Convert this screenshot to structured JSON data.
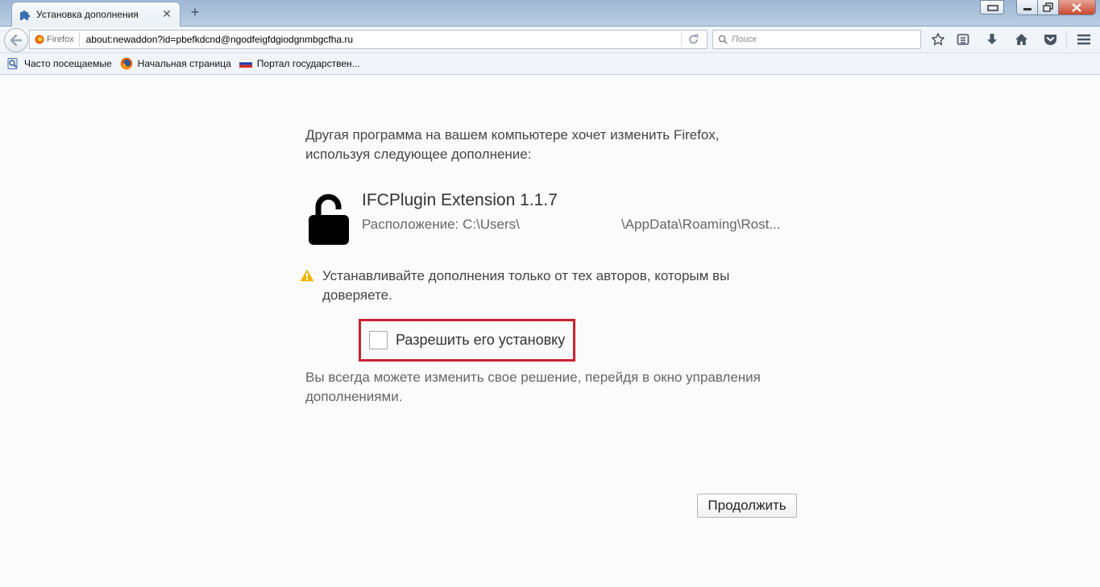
{
  "tab": {
    "title": "Установка дополнения",
    "favicon": "puzzle-piece-icon"
  },
  "navbar": {
    "identity_label": "Firefox",
    "url": "about:newaddon?id=pbefkdcnd@ngodfeigfdgiodgnmbgcfha.ru",
    "search_placeholder": "Поиск"
  },
  "bookmarks": [
    {
      "label": "Часто посещаемые",
      "icon": "bookmarks-folder-icon"
    },
    {
      "label": "Начальная страница",
      "icon": "firefox-icon"
    },
    {
      "label": "Портал государствен...",
      "icon": "russian-flag-icon"
    }
  ],
  "content": {
    "intro_line1": "Другая программа на вашем компьютере хочет изменить Firefox,",
    "intro_line2": "используя следующее дополнение:",
    "addon_name": "IFCPlugin Extension 1.1.7",
    "addon_location_prefix": "Расположение: C:\\Users\\",
    "addon_location_suffix": "\\AppData\\Roaming\\Rost...",
    "warning_line1": "Устанавливайте дополнения только от тех авторов, которым вы",
    "warning_line2": "доверяете.",
    "allow_label": "Разрешить его установку",
    "allow_checked": false,
    "note_line1": "Вы всегда можете изменить свое решение, перейдя в окно управления",
    "note_line2": "дополнениями.",
    "continue_label": "Продолжить"
  },
  "colors": {
    "highlight": "#cf2030",
    "warning": "#f0b400"
  }
}
